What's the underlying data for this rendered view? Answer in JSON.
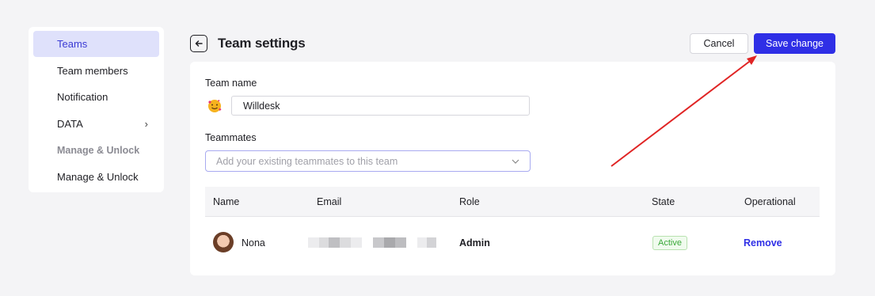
{
  "sidebar": {
    "items": [
      {
        "label": "Teams"
      },
      {
        "label": "Team members"
      },
      {
        "label": "Notification"
      },
      {
        "label": "DATA"
      },
      {
        "label": "Manage & Unlock"
      },
      {
        "label": "Manage & Unlock"
      }
    ]
  },
  "header": {
    "title": "Team settings",
    "cancel_label": "Cancel",
    "save_label": "Save change"
  },
  "form": {
    "team_name_label": "Team name",
    "team_name_value": "Willdesk",
    "teammates_label": "Teammates",
    "teammates_placeholder": "Add your existing teammates to this team"
  },
  "table": {
    "columns": [
      "Name",
      "Email",
      "Role",
      "State",
      "Operational"
    ],
    "rows": [
      {
        "name": "Nona",
        "role": "Admin",
        "state": "Active",
        "action": "Remove"
      }
    ]
  },
  "colors": {
    "accent": "#2f2fe6",
    "active_nav_bg": "#dfe1fb",
    "annotation_arrow": "#e02424",
    "status_green": "#3aa83a"
  }
}
